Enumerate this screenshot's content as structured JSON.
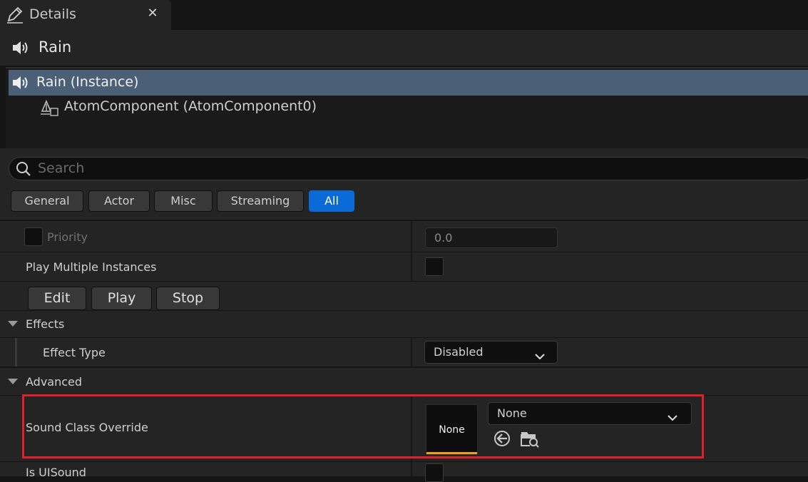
{
  "tab": {
    "title": "Details",
    "close": "✕"
  },
  "header": {
    "title": "Rain"
  },
  "tree": {
    "selected": "Rain (Instance)",
    "child": "AtomComponent (AtomComponent0)"
  },
  "search": {
    "placeholder": "Search"
  },
  "filters": [
    "General",
    "Actor",
    "Misc",
    "Streaming",
    "All"
  ],
  "active_filter": "All",
  "props": {
    "priority_label": "Priority",
    "priority_value": "0.0",
    "play_multiple_label": "Play Multiple Instances",
    "buttons": {
      "edit": "Edit",
      "play": "Play",
      "stop": "Stop"
    },
    "effects_label": "Effects",
    "effect_type_label": "Effect Type",
    "effect_type_value": "Disabled",
    "advanced_label": "Advanced",
    "sound_class_label": "Sound Class Override",
    "sound_class_thumb": "None",
    "sound_class_value": "None",
    "is_ui_sound_label": "Is UISound"
  },
  "colors": {
    "accent": "#0a6ad6",
    "selection": "#4b5f77",
    "highlight": "#e0202a",
    "thumb_bar": "#f0a020"
  },
  "icons": [
    "edit-pencil-icon",
    "close-icon",
    "speaker-icon",
    "component-icon",
    "search-icon",
    "triangle-down-icon",
    "chevron-down-icon",
    "use-selected-arrow-icon",
    "browse-folder-icon"
  ]
}
